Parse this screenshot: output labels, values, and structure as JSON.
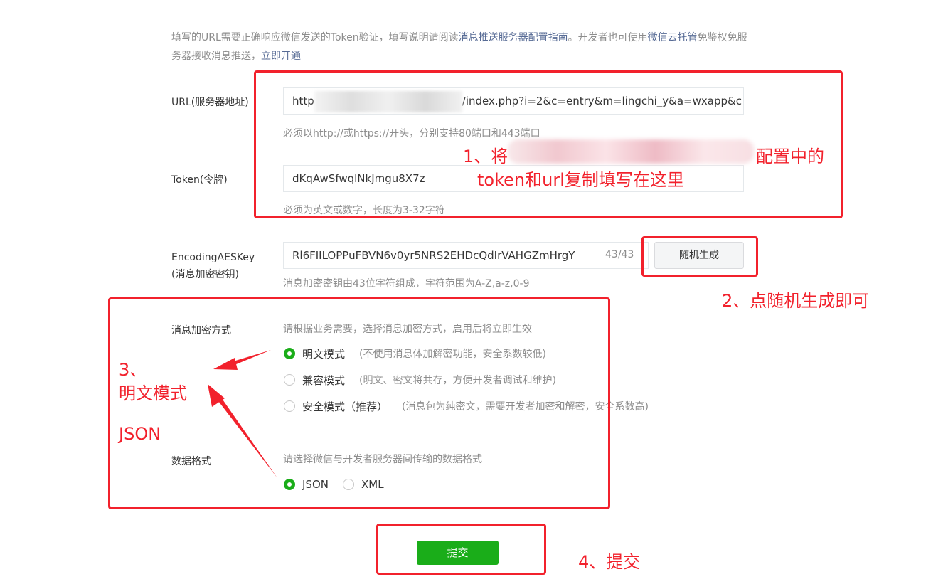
{
  "intro": {
    "text1": "填写的URL需要正确响应微信发送的Token验证，填写说明请阅读",
    "link_guide": "消息推送服务器配置指南",
    "text2": "。开发者也可使用",
    "link_cloud": "微信云托管",
    "text3": "免鉴权免服务器接收消息推送，",
    "link_open": "立即开通"
  },
  "url_field": {
    "label": "URL(服务器地址)",
    "prefix": "http",
    "value_suffix": "/index.php?i=2&c=entry&m=lingchi_y&a=wxapp&c",
    "hint": "必须以http://或https://开头，分别支持80端口和443端口"
  },
  "token_field": {
    "label": "Token(令牌)",
    "value": "dKqAwSfwqlNkJmgu8X7z",
    "hint": "必须为英文或数字，长度为3-32字符"
  },
  "aes_field": {
    "label_line1": "EncodingAESKey",
    "label_line2": "(消息加密密钥)",
    "value": "Rl6FIILOPPuFBVN6v0yr5NRS2EHDcQdIrVAHGZmHrgY",
    "counter": "43/43",
    "generate_button": "随机生成",
    "hint": "消息加密密钥由43位字符组成，字符范围为A-Z,a-z,0-9"
  },
  "encryption": {
    "label": "消息加密方式",
    "hint": "请根据业务需要，选择消息加密方式，启用后将立即生效",
    "options": [
      {
        "label": "明文模式",
        "desc": "(不使用消息体加解密功能，安全系数较低)",
        "selected": true
      },
      {
        "label": "兼容模式",
        "desc": "(明文、密文将共存，方便开发者调试和维护)",
        "selected": false
      },
      {
        "label": "安全模式（推荐）",
        "desc": "(消息包为纯密文，需要开发者加密和解密，安全系数高)",
        "selected": false
      }
    ]
  },
  "data_format": {
    "label": "数据格式",
    "hint": "请选择微信与开发者服务器间传输的数据格式",
    "options": [
      {
        "label": "JSON",
        "selected": true
      },
      {
        "label": "XML",
        "selected": false
      }
    ]
  },
  "submit_button": "提交",
  "annotations": {
    "a1_prefix": "1、将",
    "a1_suffix": "配置中的",
    "a1_line2": "token和url复制填写在这里",
    "a2": "2、点随机生成即可",
    "a3_line1": "3、",
    "a3_line2": "明文模式",
    "a3_json": "JSON",
    "a4": "4、提交"
  },
  "colors": {
    "annotation_red": "#f2212c",
    "wechat_green": "#1aad19",
    "link_blue": "#576b95",
    "hint_grey": "#8d8d8d"
  }
}
